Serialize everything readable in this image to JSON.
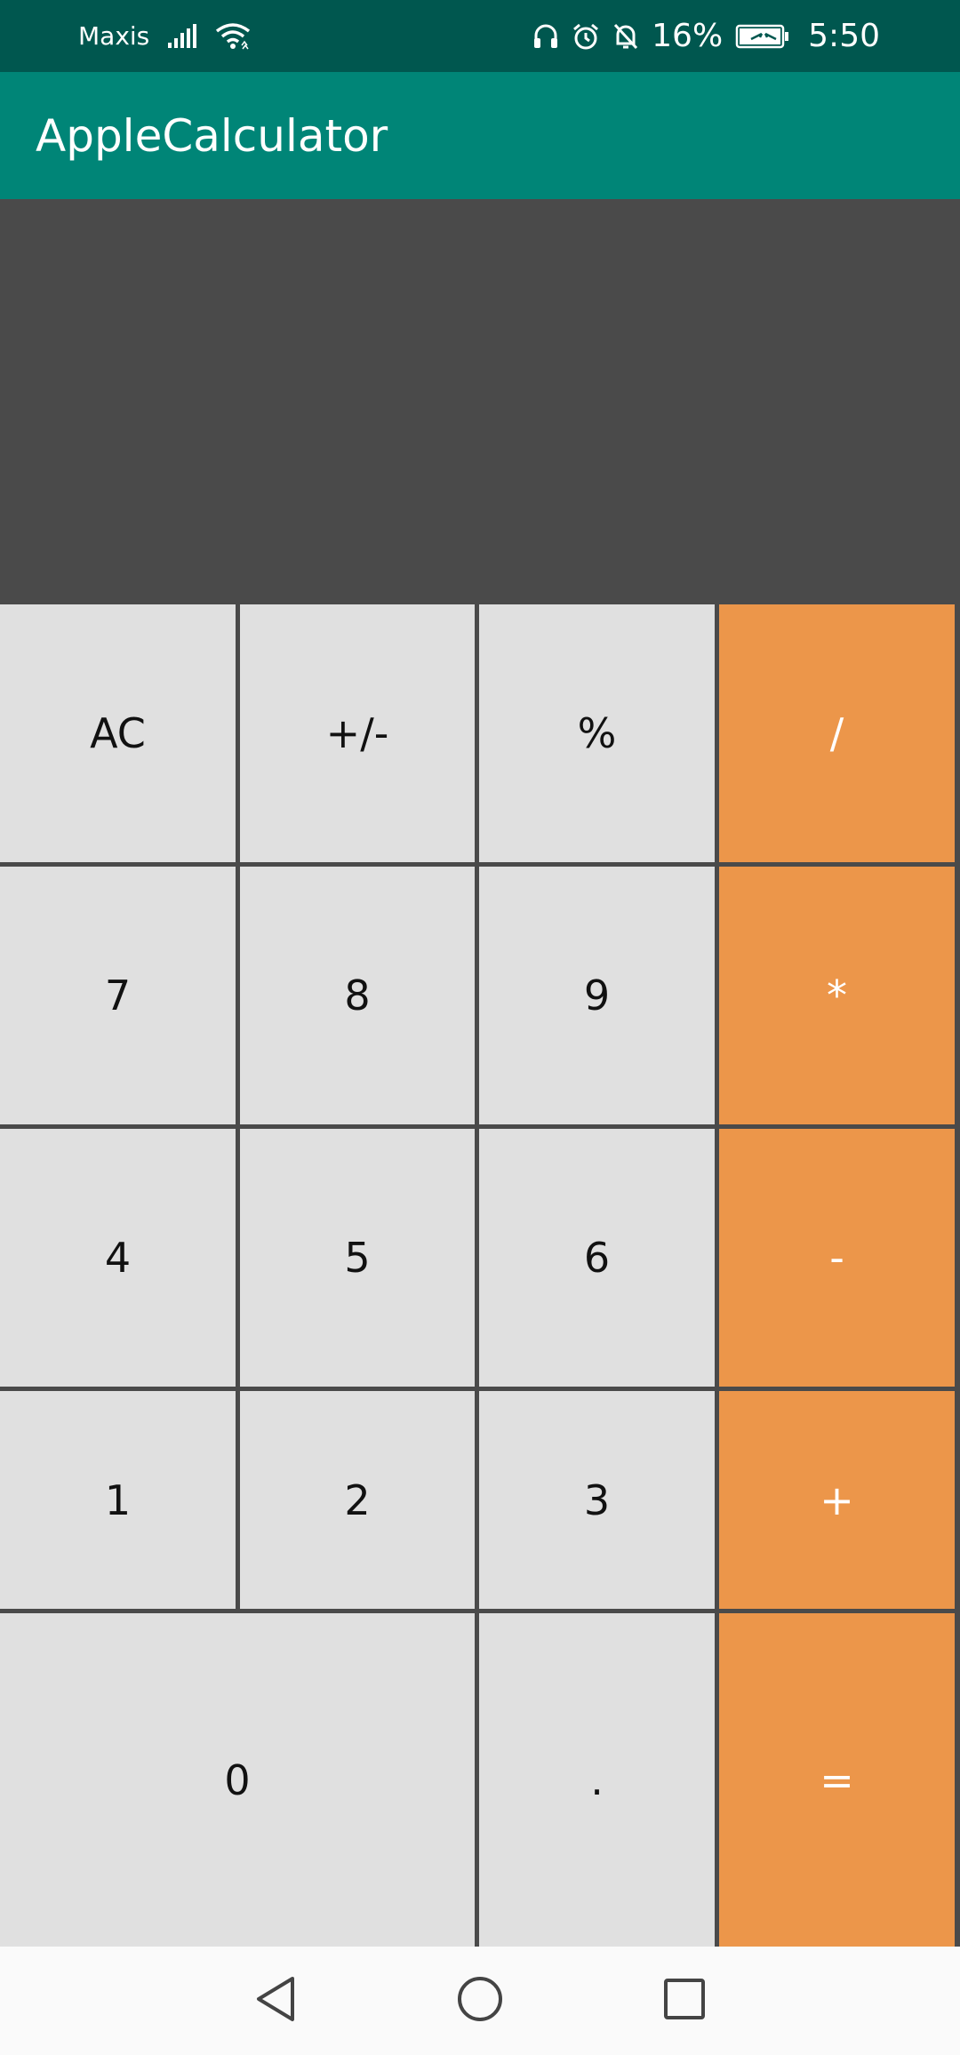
{
  "status_bar": {
    "carrier": "Maxis",
    "battery_percent": "16%",
    "time": "5:50",
    "icons": [
      "signal-icon",
      "wifi-icon",
      "headset-icon",
      "alarm-icon",
      "mute-icon",
      "battery-icon"
    ]
  },
  "app_bar": {
    "title": "AppleCalculator"
  },
  "display": {
    "value": ""
  },
  "keys": {
    "ac": "AC",
    "plus_minus": "+/-",
    "percent": "%",
    "divide": "/",
    "seven": "7",
    "eight": "8",
    "nine": "9",
    "multiply": "*",
    "four": "4",
    "five": "5",
    "six": "6",
    "minus": "-",
    "one": "1",
    "two": "2",
    "three": "3",
    "plus": "+",
    "zero": "0",
    "decimal": ".",
    "equals": "="
  },
  "nav_bar": {
    "icons": [
      "back-icon",
      "home-icon",
      "recents-icon"
    ]
  },
  "colors": {
    "status_bar": "#00574f",
    "app_bar": "#008577",
    "display_bg": "#4a4a4a",
    "key_bg": "#e0e0e0",
    "operator_bg": "#ec964a"
  }
}
